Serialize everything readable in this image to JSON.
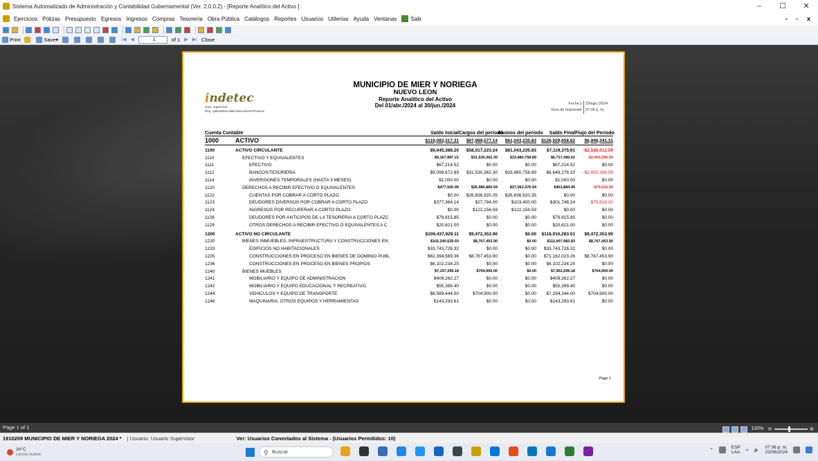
{
  "window": {
    "title": "Sistema Automatizado de Administración y Contabilidad Gubernamental  (Ver. 2.0.0.2) - [Reporte Analítico del Activo ]",
    "controls": [
      "–",
      "☐",
      "✕"
    ]
  },
  "menu": {
    "items": [
      "Ejercicios",
      "Pólizas",
      "Presupuesto",
      "Egresos",
      "Ingresos",
      "Compras",
      "Tesorería",
      "Obra Pública",
      "Catálogos",
      "Reportes",
      "Usuarios",
      "Utilerías",
      "Ayuda",
      "Ventanas"
    ],
    "salir": "Salir",
    "mdi_controls": "- ▫ x"
  },
  "viewer_toolbar": {
    "print": "Print",
    "save": "Save",
    "page_value": "1",
    "page_of": "of 1",
    "close": "Close"
  },
  "report": {
    "logo": "ndetec",
    "user_line": "User: supervisor",
    "rep_line": "Rep: rptEstadoAnaliticoDeActivosYPasivos",
    "entity": "MUNICIPIO DE MIER Y NORIEGA",
    "state": "NUEVO LEON",
    "name": "Reporte Analítico del Activo",
    "period": "Del 01/abr./2024 al 30/jun./2024",
    "fecha_label": "Fecha y",
    "fecha_value": "23/ago./2024",
    "hora_label": "hora de Impresión",
    "hora_value": "07:36 p. m.",
    "headers": {
      "code": "Cuenta Contable",
      "saldo_inicial": "Saldo Inicial",
      "cargos": "Cargos del periodo",
      "abonos": "Abonos del periodo",
      "saldo_final": "Saldo Final",
      "flujo": "Flujo del Periodo"
    },
    "page_label": "Page 1",
    "rows": [
      {
        "level": "lvl1",
        "code": "1000",
        "name": "ACTIVO",
        "si": "$119,083,317.31",
        "ca": "$67,989,577.14",
        "ab": "$61,043,235.83",
        "sf": "$126,029,658.62",
        "fl": "$6,946,341.31"
      },
      {
        "level": "lvl2",
        "code": "1100",
        "name": "ACTIVO CIRCULANTE",
        "si": "$9,645,388.20",
        "ca": "$58,517,223.24",
        "ab": "$61,043,235.83",
        "sf": "$7,119,375.61",
        "fl": "-$2,526,012.59"
      },
      {
        "level": "lvl3",
        "code": "1110",
        "name": "EFECTIVO Y EQUIVALENTES",
        "si": "$9,167,887.21",
        "ca": "$31,530,362.30",
        "ab": "$33,980,758.89",
        "sf": "$6,717,490.62",
        "fl": "-$2,450,396.59"
      },
      {
        "level": "lvl4",
        "code": "1111",
        "name": "EFECTIVO",
        "si": "$67,214.52",
        "ca": "$0.00",
        "ab": "$0.00",
        "sf": "$67,214.52",
        "fl": "$0.00"
      },
      {
        "level": "lvl4",
        "code": "1112",
        "name": "BANCOS/TESORERÍA",
        "si": "$9,099,672.69",
        "ca": "$31,530,362.30",
        "ab": "$33,980,758.89",
        "sf": "$6,649,276.10",
        "fl": "-$2,450,396.59"
      },
      {
        "level": "lvl4",
        "code": "1114",
        "name": "INVERSIONES TEMPORALES (HASTA 3 MESES)",
        "si": "$1,000.00",
        "ca": "$0.00",
        "ab": "$0.00",
        "sf": "$1,000.00",
        "fl": "$0.00"
      },
      {
        "level": "lvl3",
        "code": "1120",
        "name": "DERECHOS A RECIBIR EFECTIVO O EQUIVALENTES",
        "si": "$477,500.99",
        "ca": "$26,986,860.94",
        "ab": "$27,062,476.94",
        "sf": "$401,884.99",
        "fl": "-$75,616.00"
      },
      {
        "level": "lvl4",
        "code": "1122",
        "name": "CUENTAS POR COBRAR A CORTO PLAZO",
        "si": "$0.00",
        "ca": "$26,836,920.35",
        "ab": "$26,836,920.35",
        "sf": "$0.00",
        "fl": "$0.00"
      },
      {
        "level": "lvl4",
        "code": "1123",
        "name": "DEUDORES DIVERSOS POR COBRAR A CORTO PLAZO",
        "si": "$377,364.14",
        "ca": "$27,784.00",
        "ab": "$103,400.00",
        "sf": "$301,748.14",
        "fl": "-$75,616.00"
      },
      {
        "level": "lvl4",
        "code": "1124",
        "name": "INGRESOS POR RECUPERAR A CORTO PLAZO",
        "si": "$0.00",
        "ca": "$122,156.59",
        "ab": "$122,156.59",
        "sf": "$0.00",
        "fl": "$0.00"
      },
      {
        "level": "lvl4",
        "code": "1126",
        "name": "DEUDORES POR ANTICIPOS DE LA TESORERÍA A CORTO PLAZC",
        "si": "$79,615.85",
        "ca": "$0.00",
        "ab": "$0.00",
        "sf": "$79,615.85",
        "fl": "$0.00"
      },
      {
        "level": "lvl4",
        "code": "1129",
        "name": "OTROS DERECHOS A RECIBIR EFECTIVO O EQUIVALENTES A C",
        "si": "$20,621.00",
        "ca": "$0.00",
        "ab": "$0.00",
        "sf": "$20,621.00",
        "fl": "$0.00"
      },
      {
        "level": "lvl2",
        "code": "1200",
        "name": "ACTIVO NO CIRCULANTE",
        "si": "$109,437,929.11",
        "ca": "$9,472,353.90",
        "ab": "$0.00",
        "sf": "$118,910,283.01",
        "fl": "$9,472,353.90"
      },
      {
        "level": "lvl3",
        "code": "1230",
        "name": "BIENES INMUEBLES, INFRAESTRUCTURA Y CONSTRUCCIONES EN",
        "si": "$102,240,529.93",
        "ca": "$8,767,453.90",
        "ab": "$0.00",
        "sf": "$111,007,983.83",
        "fl": "$8,767,453.90"
      },
      {
        "level": "lvl4",
        "code": "1233",
        "name": "EDIFICIOS NO HABITACIONALES",
        "si": "$33,743,726.32",
        "ca": "$0.00",
        "ab": "$0.00",
        "sf": "$33,743,726.32",
        "fl": "$0.00"
      },
      {
        "level": "lvl4",
        "code": "1235",
        "name": "CONSTRUCCIONES EN PROCESO EN BIENES DE DOMINIO PÚBL",
        "si": "$62,394,569.36",
        "ca": "$8,767,453.90",
        "ab": "$0.00",
        "sf": "$71,162,023.26",
        "fl": "$8,767,453.90"
      },
      {
        "level": "lvl4",
        "code": "1236",
        "name": "CONSTRUCCIONES EN PROCESO EN BIENES PROPIOS",
        "si": "$6,102,234.25",
        "ca": "$0.00",
        "ab": "$0.00",
        "sf": "$6,102,234.25",
        "fl": "$0.00"
      },
      {
        "level": "lvl3",
        "code": "1240",
        "name": "BIENES MUEBLES",
        "si": "$7,197,399.18",
        "ca": "$704,900.00",
        "ab": "$0.00",
        "sf": "$7,902,299.18",
        "fl": "$704,900.00"
      },
      {
        "level": "lvl4",
        "code": "1241",
        "name": "MOBILIARIO Y EQUIPO DE ADMINISTRACIÓN",
        "si": "$409,262.27",
        "ca": "$0.00",
        "ab": "$0.00",
        "sf": "$409,262.27",
        "fl": "$0.00"
      },
      {
        "level": "lvl4",
        "code": "1242",
        "name": "MOBILIARIO Y EQUIPO EDUCACIONAL Y RECREATIVO",
        "si": "$55,399.40",
        "ca": "$0.00",
        "ab": "$0.00",
        "sf": "$55,399.40",
        "fl": "$0.00"
      },
      {
        "level": "lvl4",
        "code": "1244",
        "name": "VEHÍCULOS Y EQUIPO DE TRANSPORTE",
        "si": "$6,589,444.00",
        "ca": "$704,900.00",
        "ab": "$0.00",
        "sf": "$7,294,344.00",
        "fl": "$704,900.00"
      },
      {
        "level": "lvl4",
        "code": "1246",
        "name": "MAQUINARIA, OTROS EQUIPOS Y HERRAMIENTAS",
        "si": "$143,293.61",
        "ca": "$0.00",
        "ab": "$0.00",
        "sf": "$143,293.61",
        "fl": "$0.00"
      }
    ]
  },
  "page_strip": {
    "label": "Page 1 of 1",
    "zoom": "100%"
  },
  "status": {
    "entity": "1910209 MUNICIPIO DE MIER Y NORIEGA  2024  *",
    "user": "| Usuario: Usuario Supervisor",
    "connected": "Ver: Usuarios Conectados al Sistema - (Usuarios Permitidos: 10)"
  },
  "taskbar": {
    "temp": "34°C",
    "weather": "Lluvia suave",
    "search_placeholder": "Buscar",
    "lang_top": "ESP",
    "lang_bottom": "LAA",
    "time": "07:36 p. m.",
    "date": "23/08/2024",
    "app_colors": [
      "#e8a317",
      "#333333",
      "#3a6ab8",
      "#1e88e5",
      "#2196f3",
      "#1565c0",
      "#37474f",
      "#c8a000",
      "#0078d4",
      "#e64a19",
      "#0277bd",
      "#1976d2",
      "#2e7d32",
      "#7b1fa2"
    ]
  }
}
